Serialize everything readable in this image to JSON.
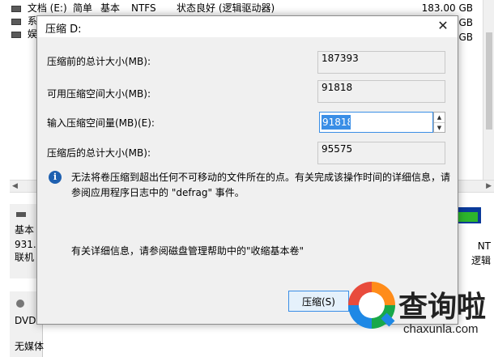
{
  "background": {
    "volumes": [
      {
        "name": "文档 (E:)",
        "layout": "简单",
        "type": "基本",
        "fs": "NTFS",
        "status": "状态良好 (逻辑驱动器)",
        "capacity": "183.00 GB"
      },
      {
        "name": "系",
        "capacity": "GB"
      },
      {
        "name": "娱",
        "capacity": "GB"
      }
    ],
    "disk1": {
      "title": "基本",
      "size": "931.",
      "state": "联机"
    },
    "disk2": {
      "title": "DVD",
      "state": "无媒体"
    },
    "right_labels": [
      "NT",
      "逻辑"
    ]
  },
  "dialog": {
    "title": "压缩 D:",
    "total_before_label": "压缩前的总计大小(MB):",
    "total_before_value": "187393",
    "available_label": "可用压缩空间大小(MB):",
    "available_value": "91818",
    "input_label": "输入压缩空间量(MB)(E):",
    "input_value": "91818",
    "total_after_label": "压缩后的总计大小(MB):",
    "total_after_value": "95575",
    "info_text": "无法将卷压缩到超出任何不可移动的文件所在的点。有关完成该操作时间的详细信息，请参阅应用程序日志中的 \"defrag\" 事件。",
    "help_text": "有关详细信息，请参阅磁盘管理帮助中的\"收缩基本卷\"",
    "shrink_button": "压缩(S)"
  },
  "watermark": {
    "cn": "查询啦",
    "en": "chaxunla.com"
  },
  "colors": {
    "accent": "#3a8ee6",
    "dialog_bg": "#f0f0f0",
    "info_icon": "#1e60b0"
  }
}
